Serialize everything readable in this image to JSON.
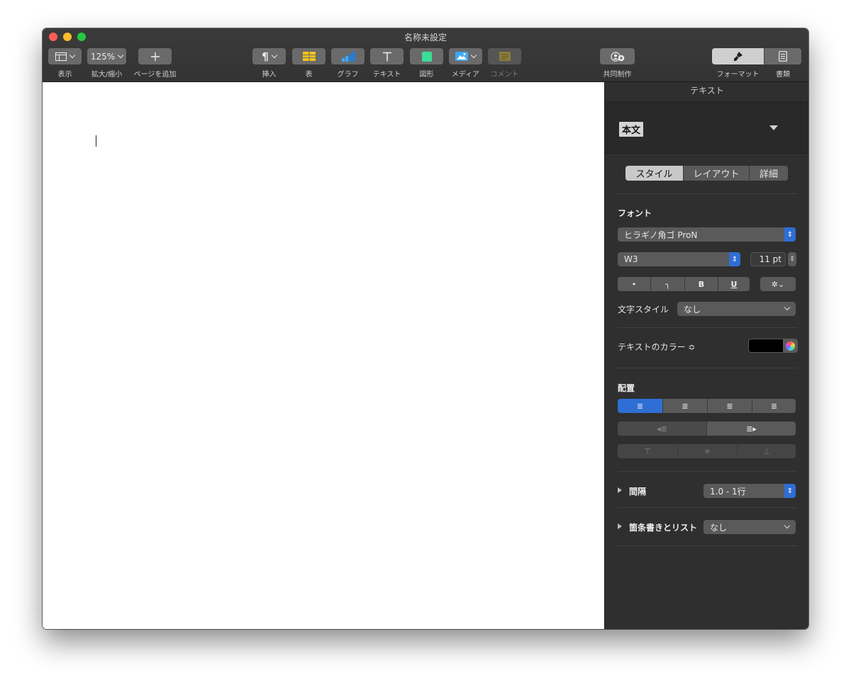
{
  "window": {
    "title": "名称未設定"
  },
  "toolbar": {
    "view_label": "表示",
    "zoom_value": "125%",
    "zoom_label": "拡大/縮小",
    "add_page_label": "ページを追加",
    "insert_label": "挿入",
    "table_label": "表",
    "chart_label": "グラフ",
    "text_label": "テキスト",
    "shape_label": "図形",
    "media_label": "メディア",
    "comment_label": "コメント",
    "collab_label": "共同制作",
    "format_label": "フォーマット",
    "document_label": "書類"
  },
  "sidebar": {
    "header": "テキスト",
    "paragraph_style": "本文",
    "tabs": [
      "スタイル",
      "レイアウト",
      "詳細"
    ],
    "font_section": "フォント",
    "font_name": "ヒラギノ角ゴ ProN",
    "font_weight": "W3",
    "font_size": "11 pt",
    "style_buttons": [
      "•",
      "╮",
      "B",
      "U"
    ],
    "char_style_label": "文字スタイル",
    "char_style_value": "なし",
    "text_color_label": "テキストのカラー ≎",
    "text_color": "#000000",
    "alignment_section": "配置",
    "spacing_label": "間隔",
    "spacing_value": "1.0 - 1行",
    "bullets_label": "箇条書きとリスト",
    "bullets_value": "なし"
  }
}
